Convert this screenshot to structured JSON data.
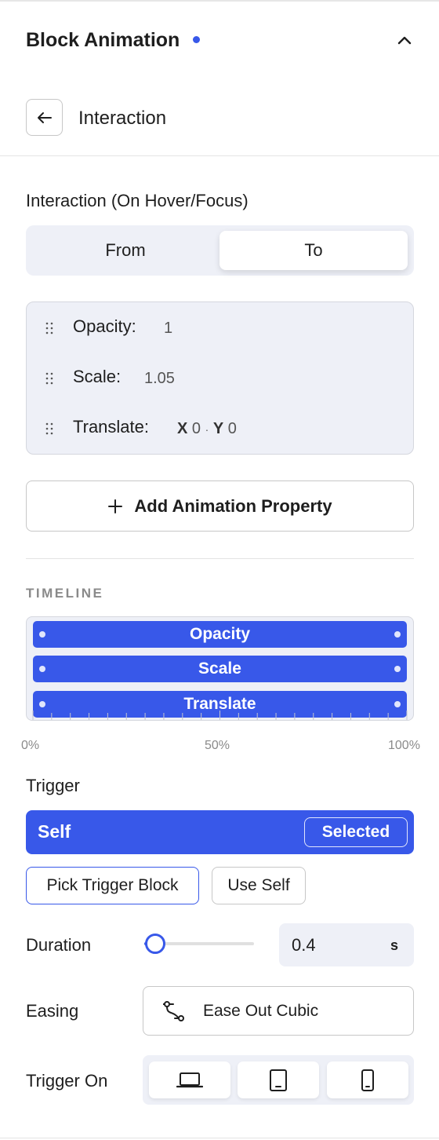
{
  "panel": {
    "title": "Block Animation",
    "accent_color": "#3858e9",
    "collapse_icon": "chevron-up-icon"
  },
  "subheader": {
    "back_icon": "arrow-left-icon",
    "title": "Interaction"
  },
  "interaction": {
    "section_title": "Interaction (On Hover/Focus)",
    "tabs": [
      {
        "label": "From",
        "selected": false
      },
      {
        "label": "To",
        "selected": true
      }
    ],
    "properties": [
      {
        "name": "Opacity:",
        "value": "1"
      },
      {
        "name": "Scale:",
        "value": "1.05"
      },
      {
        "name": "Translate:",
        "x_label": "X",
        "x_value": "0",
        "separator": "·",
        "y_label": "Y",
        "y_value": "0"
      }
    ],
    "add_button_label": "Add Animation Property",
    "add_button_icon": "plus-icon"
  },
  "timeline": {
    "title": "TIMELINE",
    "tracks": [
      "Opacity",
      "Scale",
      "Translate"
    ],
    "scale_labels": [
      "0%",
      "50%",
      "100%"
    ]
  },
  "trigger": {
    "label": "Trigger",
    "current": "Self",
    "badge": "Selected",
    "pick_button": "Pick Trigger Block",
    "use_self_button": "Use Self"
  },
  "duration": {
    "label": "Duration",
    "value": "0.4",
    "unit": "s",
    "slider_fraction": 0.1
  },
  "easing": {
    "label": "Easing",
    "value": "Ease Out Cubic",
    "icon": "bezier-curve-icon"
  },
  "trigger_on": {
    "label": "Trigger On",
    "devices": [
      "desktop-icon",
      "tablet-icon",
      "mobile-icon"
    ]
  }
}
